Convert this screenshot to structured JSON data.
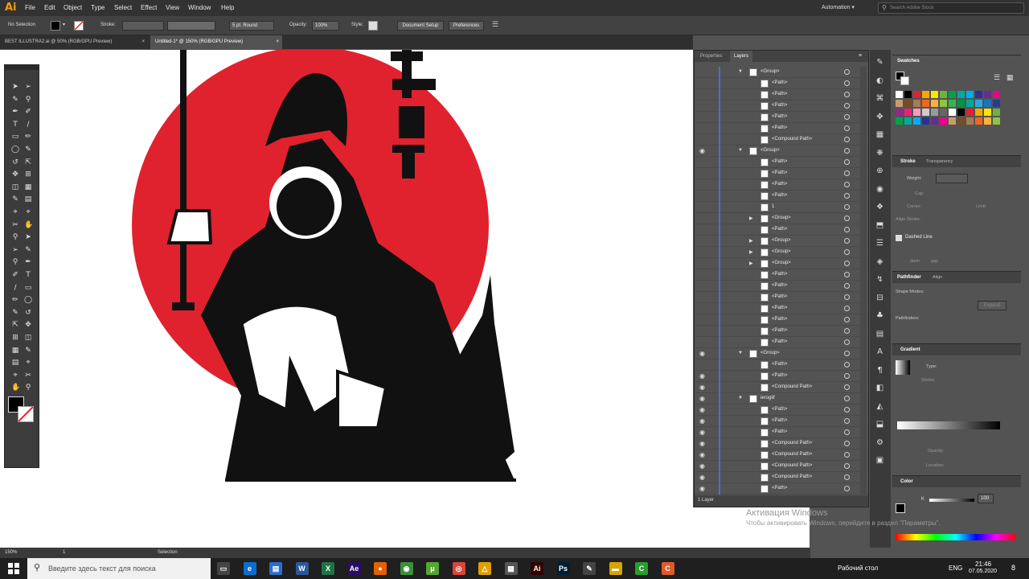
{
  "app": {
    "logo": "Ai"
  },
  "menu": [
    "File",
    "Edit",
    "Object",
    "Type",
    "Select",
    "Effect",
    "View",
    "Window",
    "Help"
  ],
  "menu_right": {
    "workspace": "Automation",
    "search_placeholder": "Search Adobe Stock"
  },
  "control": {
    "selection": "No Selection",
    "stroke_label": "Stroke:",
    "brush": "5 pt. Round",
    "opacity_label": "Opacity:",
    "opacity": "100%",
    "style_label": "Style:",
    "doc_setup": "Document Setup",
    "preferences": "Preferences"
  },
  "tabs": [
    {
      "label": "BEST ILLUSTRA2.ai @ 50% (RGB/GPU Preview)"
    },
    {
      "label": "Untitled-1* @ 150% (RGB/GPU Preview)"
    }
  ],
  "layers_panel": {
    "tab1": "Properties",
    "tab2": "Layers",
    "footer": "1 Layer",
    "rows": [
      {
        "name": "<Group>",
        "level": 0,
        "exp": "down",
        "eye": false
      },
      {
        "name": "<Path>",
        "level": 1,
        "exp": "",
        "eye": false
      },
      {
        "name": "<Path>",
        "level": 1,
        "exp": "",
        "eye": false
      },
      {
        "name": "<Path>",
        "level": 1,
        "exp": "",
        "eye": false
      },
      {
        "name": "<Path>",
        "level": 1,
        "exp": "",
        "eye": false
      },
      {
        "name": "<Path>",
        "level": 1,
        "exp": "",
        "eye": false
      },
      {
        "name": "<Compound Path>",
        "level": 1,
        "exp": "",
        "eye": false
      },
      {
        "name": "<Group>",
        "level": 0,
        "exp": "down",
        "eye": true
      },
      {
        "name": "<Path>",
        "level": 1,
        "exp": "",
        "eye": false
      },
      {
        "name": "<Path>",
        "level": 1,
        "exp": "",
        "eye": false
      },
      {
        "name": "<Path>",
        "level": 1,
        "exp": "",
        "eye": false
      },
      {
        "name": "<Path>",
        "level": 1,
        "exp": "",
        "eye": false
      },
      {
        "name": "1",
        "level": 1,
        "exp": "",
        "eye": false
      },
      {
        "name": "<Group>",
        "level": 1,
        "exp": "right",
        "eye": false
      },
      {
        "name": "<Path>",
        "level": 1,
        "exp": "",
        "eye": false
      },
      {
        "name": "<Group>",
        "level": 1,
        "exp": "right",
        "eye": false
      },
      {
        "name": "<Group>",
        "level": 1,
        "exp": "right",
        "eye": false
      },
      {
        "name": "<Group>",
        "level": 1,
        "exp": "right",
        "eye": false
      },
      {
        "name": "<Path>",
        "level": 1,
        "exp": "",
        "eye": false
      },
      {
        "name": "<Path>",
        "level": 1,
        "exp": "",
        "eye": false
      },
      {
        "name": "<Path>",
        "level": 1,
        "exp": "",
        "eye": false
      },
      {
        "name": "<Path>",
        "level": 1,
        "exp": "",
        "eye": false
      },
      {
        "name": "<Path>",
        "level": 1,
        "exp": "",
        "eye": false
      },
      {
        "name": "<Path>",
        "level": 1,
        "exp": "",
        "eye": false
      },
      {
        "name": "<Path>",
        "level": 1,
        "exp": "",
        "eye": false
      },
      {
        "name": "<Group>",
        "level": 0,
        "exp": "down",
        "eye": true
      },
      {
        "name": "<Path>",
        "level": 1,
        "exp": "",
        "eye": false
      },
      {
        "name": "<Path>",
        "level": 1,
        "exp": "",
        "eye": true
      },
      {
        "name": "<Compound Path>",
        "level": 1,
        "exp": "",
        "eye": true
      },
      {
        "name": "ieroglif",
        "level": 0,
        "exp": "down",
        "eye": true
      },
      {
        "name": "<Path>",
        "level": 1,
        "exp": "",
        "eye": true
      },
      {
        "name": "<Path>",
        "level": 1,
        "exp": "",
        "eye": true
      },
      {
        "name": "<Path>",
        "level": 1,
        "exp": "",
        "eye": true
      },
      {
        "name": "<Compound Path>",
        "level": 1,
        "exp": "",
        "eye": true
      },
      {
        "name": "<Compound Path>",
        "level": 1,
        "exp": "",
        "eye": true
      },
      {
        "name": "<Compound Path>",
        "level": 1,
        "exp": "",
        "eye": true
      },
      {
        "name": "<Compound Path>",
        "level": 1,
        "exp": "",
        "eye": true
      },
      {
        "name": "<Path>",
        "level": 1,
        "exp": "",
        "eye": true
      }
    ]
  },
  "swatches": {
    "title": "Swatches"
  },
  "stroke": {
    "title": "Stroke",
    "tab2": "Transparency",
    "weight": "Weight:",
    "cap": "Cap:",
    "corner": "Corner:",
    "limit": "Limit:",
    "align": "Align Stroke:",
    "dashed": "Dashed Line",
    "dash": "dash",
    "gap": "gap"
  },
  "pathfinder": {
    "title": "Pathfinder",
    "tab2": "Align",
    "modes": "Shape Modes:",
    "expand": "Expand",
    "pathfinders": "Pathfinders:"
  },
  "gradient": {
    "title": "Gradient",
    "type": "Type:",
    "stroke": "Stroke:",
    "opacity": "Opacity:",
    "location": "Location:"
  },
  "color": {
    "title": "Color",
    "k_label": "K",
    "k_value": "100"
  },
  "watermark": {
    "line1": "Активация Windows",
    "line2": "Чтобы активировать Windows, перейдите в раздел \"Параметры\"."
  },
  "status": {
    "zoom": "150%",
    "page": "1",
    "tool": "Selection"
  },
  "taskbar": {
    "search": "Введите здесь текст для поиска",
    "desktop": "Рабочий стол",
    "lang": "ENG",
    "time": "21:46",
    "date": "07.05.2020",
    "notif": "8"
  },
  "colors": {
    "accent_red": "#e0222e",
    "ai_orange": "#ff9a00"
  }
}
